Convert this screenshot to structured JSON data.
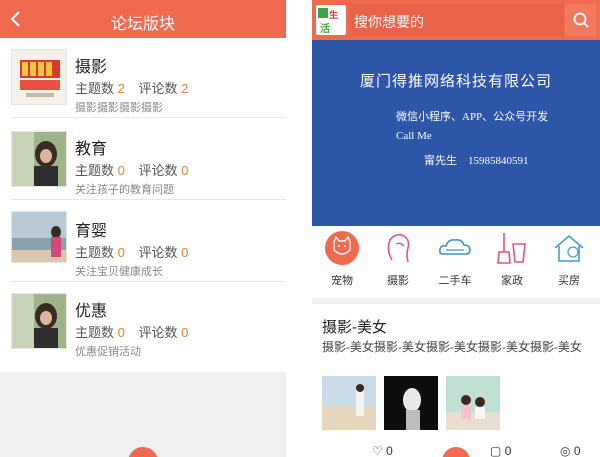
{
  "left": {
    "header": {
      "title": "论坛版块"
    },
    "forums": [
      {
        "name": "摄影",
        "topics_label": "主题数",
        "topics": "2",
        "comments_label": "评论数",
        "comments": "2",
        "desc": "摄影摄影摄影摄影"
      },
      {
        "name": "教育",
        "topics_label": "主题数",
        "topics": "0",
        "comments_label": "评论数",
        "comments": "0",
        "desc": "关注孩子的教育问题"
      },
      {
        "name": "育婴",
        "topics_label": "主题数",
        "topics": "0",
        "comments_label": "评论数",
        "comments": "0",
        "desc": "关注宝贝健康成长"
      },
      {
        "name": "优惠",
        "topics_label": "主题数",
        "topics": "0",
        "comments_label": "评论数",
        "comments": "0",
        "desc": "优惠促销活动"
      }
    ]
  },
  "right": {
    "logo": {
      "text_top": "生",
      "text_bottom": "活"
    },
    "search": {
      "placeholder": "搜你想要的"
    },
    "banner": {
      "company": "厦门得推网络科技有限公司",
      "line1": "微信小程序、APP、公众号开发",
      "line2": "Call Me",
      "line3": "甯先生　15985840591"
    },
    "categories": [
      {
        "label": "宠物",
        "icon": "cat-icon"
      },
      {
        "label": "摄影",
        "icon": "woman-head-icon"
      },
      {
        "label": "二手车",
        "icon": "cloud-car-icon"
      },
      {
        "label": "家政",
        "icon": "broom-bucket-icon"
      },
      {
        "label": "买房",
        "icon": "house-yen-icon"
      }
    ],
    "post": {
      "title": "摄影-美女",
      "excerpt": "摄影-美女摄影-美女摄影-美女摄影-美女摄影-美女",
      "likes": "0",
      "comments": "0",
      "views": "0"
    }
  },
  "colors": {
    "accent": "#ef6a4e",
    "banner": "#2e56a8",
    "count": "#ef7d2f"
  }
}
